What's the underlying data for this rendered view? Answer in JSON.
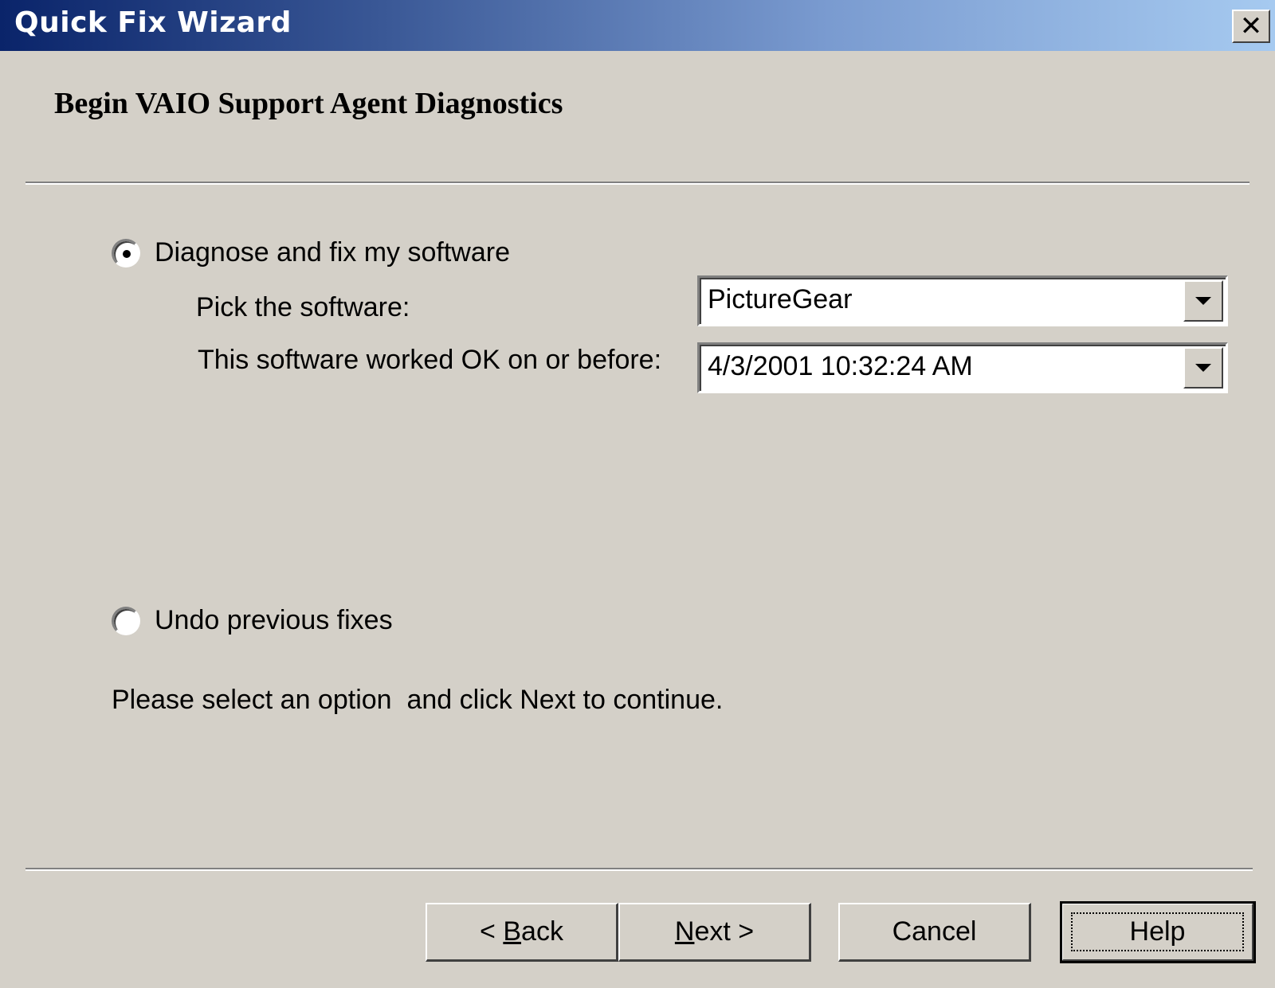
{
  "window": {
    "title": "Quick Fix Wizard",
    "close_label": "✕"
  },
  "heading": "Begin VAIO Support Agent Diagnostics",
  "options": {
    "diagnose": {
      "label": "Diagnose and fix my software",
      "selected": true
    },
    "undo": {
      "label": "Undo previous fixes",
      "selected": false
    }
  },
  "software": {
    "label": "Pick the software:",
    "value": "PictureGear"
  },
  "worked_before": {
    "label": "This software worked OK on or before:",
    "value": "4/3/2001 10:32:24 AM"
  },
  "instruction": "Please select an option  and click Next to continue.",
  "buttons": {
    "back": {
      "prefix": "< ",
      "mnemonic": "B",
      "rest": "ack"
    },
    "next": {
      "mnemonic": "N",
      "rest": "ext >"
    },
    "cancel": "Cancel",
    "help": "Help"
  }
}
